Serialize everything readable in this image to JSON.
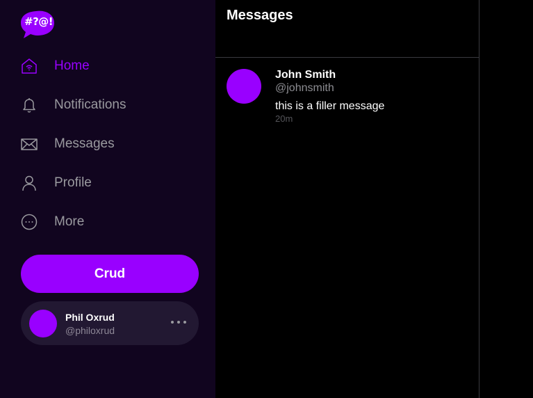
{
  "brand": {
    "logo_text": "#?@!",
    "accent_color": "#9900ff"
  },
  "sidebar": {
    "items": [
      {
        "label": "Home",
        "icon": "home-icon",
        "active": true
      },
      {
        "label": "Notifications",
        "icon": "bell-icon",
        "active": false
      },
      {
        "label": "Messages",
        "icon": "envelope-icon",
        "active": false
      },
      {
        "label": "Profile",
        "icon": "user-icon",
        "active": false
      },
      {
        "label": "More",
        "icon": "more-circle-icon",
        "active": false
      }
    ],
    "primary_button_label": "Crud"
  },
  "current_user": {
    "name": "Phil Oxrud",
    "handle": "@philoxrud"
  },
  "main": {
    "title": "Messages",
    "messages": [
      {
        "name": "John Smith",
        "handle": "@johnsmith",
        "text": "this is a filler message",
        "time": "20m"
      }
    ]
  }
}
